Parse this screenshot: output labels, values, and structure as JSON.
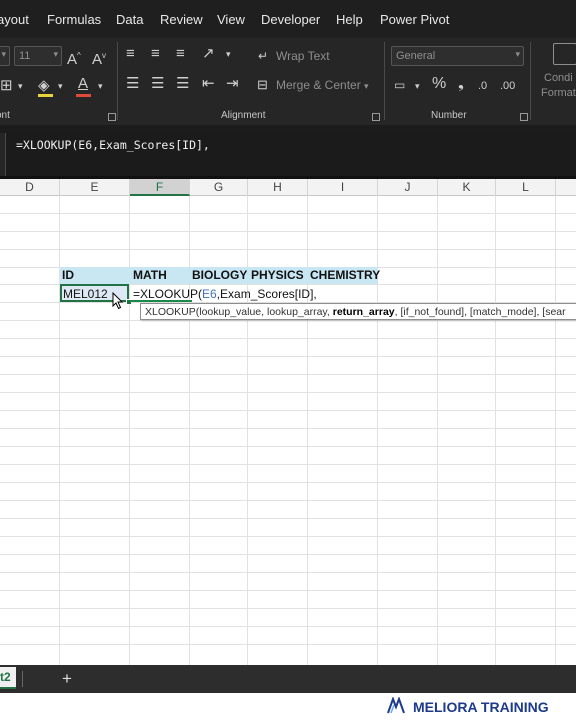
{
  "menu": [
    "ayout",
    "Formulas",
    "Data",
    "Review",
    "View",
    "Developer",
    "Help",
    "Power Pivot"
  ],
  "ribbon": {
    "font_size": "11",
    "wrap_text": "Wrap Text",
    "merge_center": "Merge & Center",
    "number_format": "General",
    "cond_format_1": "Condi",
    "cond_format_2": "Format",
    "groups": {
      "font": "ont",
      "alignment": "Alignment",
      "number": "Number"
    }
  },
  "formula_bar": {
    "text": "=XLOOKUP(E6,Exam_Scores[ID],"
  },
  "columns": [
    "D",
    "E",
    "F",
    "G",
    "H",
    "I",
    "J",
    "K",
    "L"
  ],
  "headers": [
    "ID",
    "MATH",
    "BIOLOGY",
    "PHYSICS",
    "CHEMISTRY"
  ],
  "cells": {
    "id_value": "MEL012",
    "edit_prefix": "=XLOOKUP(",
    "edit_ref": "E6",
    "edit_suffix": ",Exam_Scores[ID],"
  },
  "tooltip": {
    "before": "XLOOKUP(lookup_value, lookup_array, ",
    "bold": "return_array",
    "after": ", [if_not_found], [match_mode], [sear"
  },
  "sheet_tabs": {
    "active": "t2",
    "add": "+"
  },
  "brand": {
    "text": "MELIORA TRAINING",
    "color": "#1e3a8a"
  },
  "colors": {
    "accent_green": "#217346",
    "header_fill": "#c9e6f3",
    "ref_blue": "#3f74b8"
  }
}
